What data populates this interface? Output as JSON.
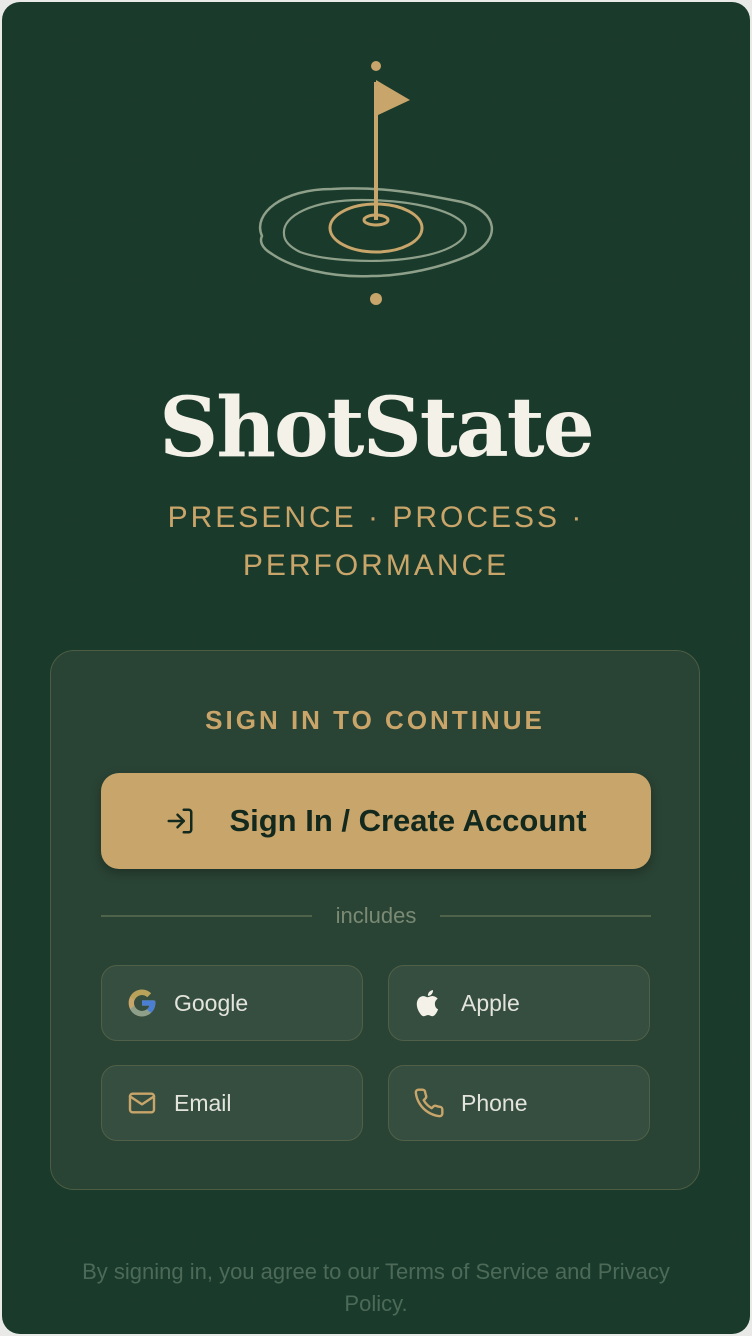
{
  "brand": {
    "name": "ShotState",
    "tagline": "PRESENCE · PROCESS · PERFORMANCE"
  },
  "signin": {
    "title": "SIGN IN TO CONTINUE",
    "primary_label": "Sign In / Create Account",
    "divider_label": "includes",
    "options": [
      {
        "label": "Google",
        "icon": "google-icon"
      },
      {
        "label": "Apple",
        "icon": "apple-icon"
      },
      {
        "label": "Email",
        "icon": "mail-icon"
      },
      {
        "label": "Phone",
        "icon": "phone-icon"
      }
    ]
  },
  "legal": {
    "text": "By signing in, you agree to our Terms of Service and Privacy Policy."
  },
  "colors": {
    "background": "#0f2a1f",
    "gold": "#c8a56a",
    "text_light": "#f4f1e8"
  }
}
